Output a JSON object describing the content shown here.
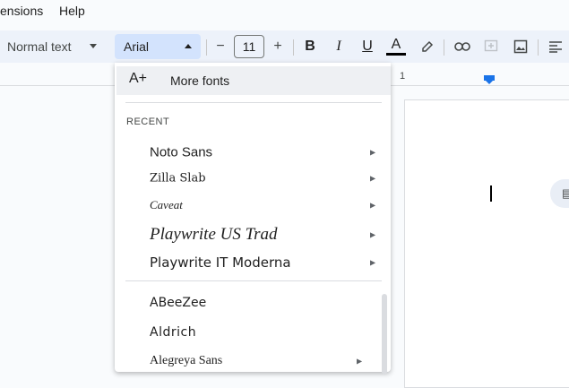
{
  "menubar": {
    "items": [
      {
        "label": "ensions"
      },
      {
        "label": "Help"
      }
    ]
  },
  "toolbar": {
    "styles": "Normal text",
    "font": "Arial",
    "size": "11",
    "decrease": "−",
    "increase": "+",
    "bold": "B",
    "italic": "I",
    "underline": "U",
    "text_color": "A"
  },
  "ruler": {
    "number": "1"
  },
  "dropdown": {
    "more_fonts": "More fonts",
    "recent_heading": "RECENT",
    "recent": [
      {
        "name": "Noto Sans"
      },
      {
        "name": "Zilla Slab"
      },
      {
        "name": "Caveat"
      },
      {
        "name": "Playwrite US Trad"
      },
      {
        "name": "Playwrite IT Moderna"
      }
    ],
    "all": [
      {
        "name": "ABeeZee"
      },
      {
        "name": "Aldrich"
      },
      {
        "name": "Alegreya Sans"
      }
    ]
  },
  "colors": {
    "accent": "#1a73e8",
    "toolbar_bg": "#edf2fa",
    "font_select_bg": "#d3e3fd"
  }
}
